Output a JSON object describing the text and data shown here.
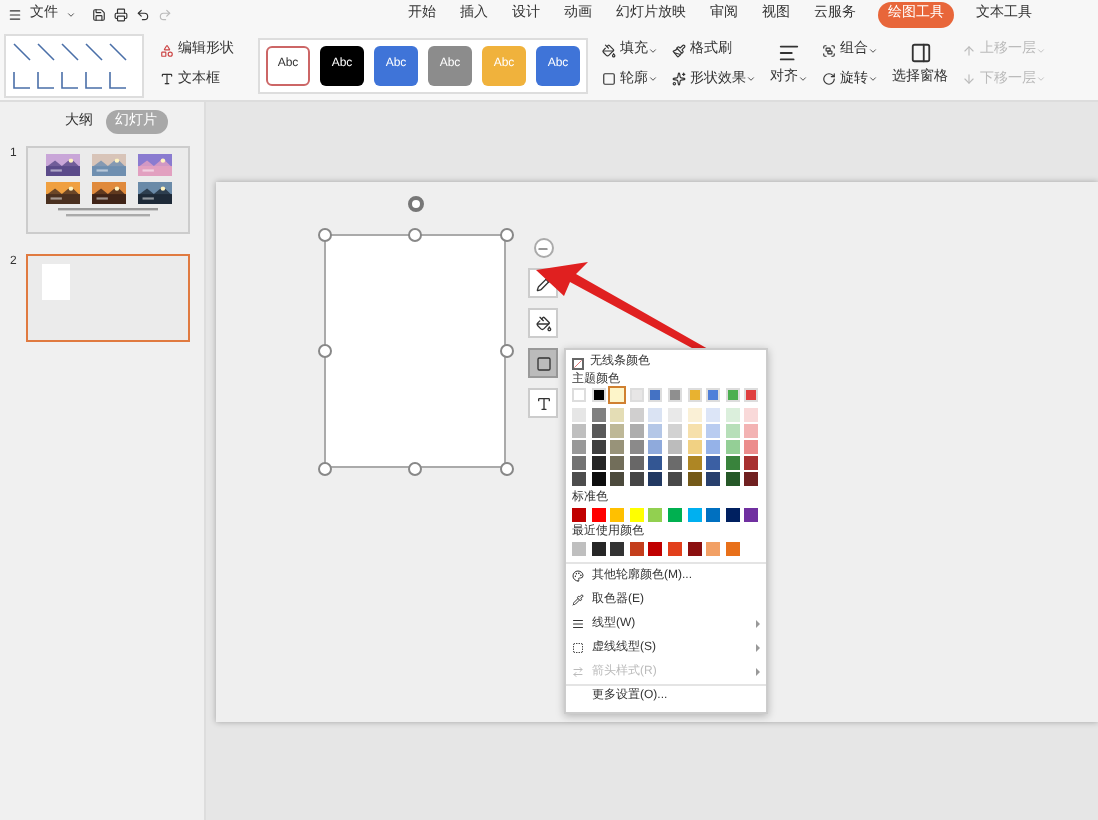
{
  "menu": {
    "label": "文件"
  },
  "tabs": [
    {
      "label": "开始",
      "selected": false
    },
    {
      "label": "插入",
      "selected": false
    },
    {
      "label": "设计",
      "selected": false
    },
    {
      "label": "动画",
      "selected": false
    },
    {
      "label": "幻灯片放映",
      "selected": false
    },
    {
      "label": "审阅",
      "selected": false
    },
    {
      "label": "视图",
      "selected": false
    },
    {
      "label": "云服务",
      "selected": false
    },
    {
      "label": "绘图工具",
      "selected": true
    },
    {
      "label": "文本工具",
      "selected": false
    }
  ],
  "ribbon": {
    "edit_shape": "编辑形状",
    "text_box": "文本框",
    "shape_styles": [
      {
        "label": "Abc",
        "color": "#ffffff",
        "selected": true
      },
      {
        "label": "Abc",
        "color": "#000000",
        "selected": false
      },
      {
        "label": "Abc",
        "color": "#3f74d8",
        "selected": false
      },
      {
        "label": "Abc",
        "color": "#8c8c8c",
        "selected": false
      },
      {
        "label": "Abc",
        "color": "#f0b23c",
        "selected": false
      },
      {
        "label": "Abc",
        "color": "#3f74d8",
        "selected": false
      }
    ],
    "command_columns": [
      [
        {
          "label": "填充",
          "dropdown": true,
          "disabled": false
        },
        {
          "label": "轮廓",
          "dropdown": true,
          "disabled": false
        }
      ],
      [
        {
          "label": "格式刷",
          "dropdown": false,
          "disabled": false
        },
        {
          "label": "形状效果",
          "dropdown": true,
          "disabled": false
        }
      ],
      [
        {
          "label": "对齐",
          "dropdown": true,
          "disabled": false
        }
      ],
      [
        {
          "label": "组合",
          "dropdown": true,
          "disabled": false
        },
        {
          "label": "旋转",
          "dropdown": true,
          "disabled": false
        }
      ],
      [
        {
          "label": "选择窗格",
          "dropdown": false,
          "disabled": false
        }
      ],
      [
        {
          "label": "上移一层",
          "dropdown": true,
          "disabled": true
        },
        {
          "label": "下移一层",
          "dropdown": true,
          "disabled": true
        }
      ]
    ]
  },
  "panel_tabs": [
    {
      "label": "大纲",
      "selected": false
    },
    {
      "label": "幻灯片",
      "selected": true
    }
  ],
  "slides": [
    {
      "number": "1",
      "kind": "photos",
      "selected": false
    },
    {
      "number": "2",
      "kind": "blank",
      "selected": true
    }
  ],
  "outline_menu": {
    "no_line": "无线条颜色",
    "theme_heading": "主题颜色",
    "theme_colors": [
      {
        "color": "#ffffff",
        "selected": false
      },
      {
        "color": "#000000",
        "selected": false
      },
      {
        "color": "#fdf5c9",
        "selected": true
      },
      {
        "color": "#e7e6e6",
        "selected": false
      },
      {
        "color": "#4472c4",
        "selected": false
      },
      {
        "color": "#8f8f8f",
        "selected": false
      },
      {
        "color": "#e8b230",
        "selected": false
      },
      {
        "color": "#4f7fd9",
        "selected": false
      },
      {
        "color": "#4caf50",
        "selected": false
      },
      {
        "color": "#e04040",
        "selected": false
      }
    ],
    "standard_heading": "标准色",
    "standard_colors": [
      {
        "color": "#c00000"
      },
      {
        "color": "#ff0000"
      },
      {
        "color": "#ffc000"
      },
      {
        "color": "#ffff00"
      },
      {
        "color": "#92d050"
      },
      {
        "color": "#00b050"
      },
      {
        "color": "#00b0f0"
      },
      {
        "color": "#0070c0"
      },
      {
        "color": "#002060"
      },
      {
        "color": "#7030a0"
      }
    ],
    "recent_heading": "最近使用颜色",
    "recent_colors": [
      {
        "color": "#bfbfbf"
      },
      {
        "color": "#262626"
      },
      {
        "color": "#333333"
      },
      {
        "color": "#c43e1c"
      },
      {
        "color": "#c00000"
      },
      {
        "color": "#e2401c"
      },
      {
        "color": "#8b0f0f"
      },
      {
        "color": "#f2a065"
      },
      {
        "color": "#e8701a"
      }
    ],
    "items": [
      {
        "label": "其他轮廓颜色(M)...",
        "submenu": false,
        "disabled": false
      },
      {
        "label": "取色器(E)",
        "submenu": false,
        "disabled": false
      },
      {
        "label": "线型(W)",
        "submenu": true,
        "disabled": false
      },
      {
        "label": "虚线线型(S)",
        "submenu": true,
        "disabled": false
      },
      {
        "label": "箭头样式(R)",
        "submenu": true,
        "disabled": true
      },
      {
        "label": "更多设置(O)...",
        "submenu": false,
        "disabled": false
      }
    ]
  }
}
